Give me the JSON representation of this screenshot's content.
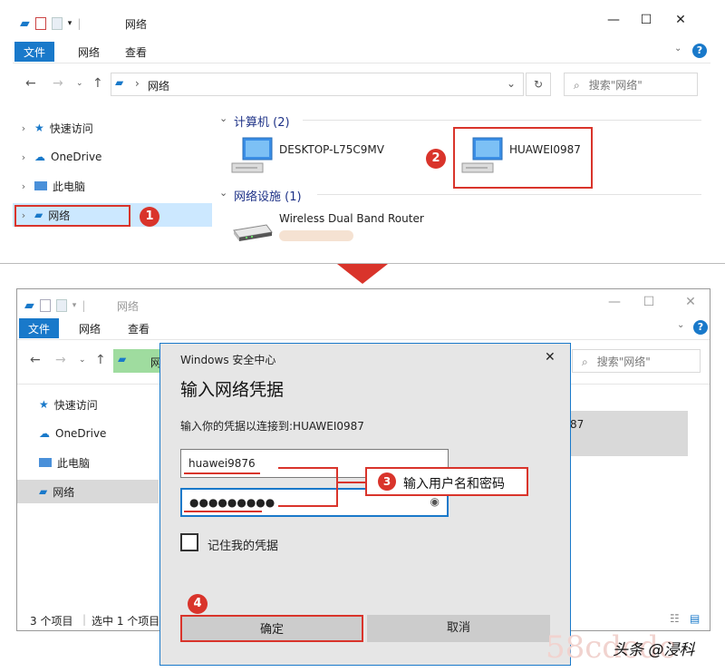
{
  "top": {
    "title": "网络",
    "ribbon_tabs": [
      "文件",
      "网络",
      "查看"
    ],
    "address": "网络",
    "search_placeholder": "搜索\"网络\"",
    "sidebar": [
      "快速访问",
      "OneDrive",
      "此电脑",
      "网络"
    ],
    "group_computers": "计算机 (2)",
    "group_devices": "网络设施 (1)",
    "computers": [
      "DESKTOP-L75C9MV",
      "HUAWEI0987"
    ],
    "device": "Wireless Dual Band Router",
    "badges": [
      "1",
      "2"
    ]
  },
  "bottom": {
    "title": "网络",
    "ribbon_tabs": [
      "文件",
      "网络",
      "查看"
    ],
    "address_partial": "网",
    "search_placeholder": "搜索\"网络\"",
    "sidebar": [
      "快速访问",
      "OneDrive",
      "此电脑",
      "网络"
    ],
    "partial_item": "87",
    "status_count": "3 个项目",
    "status_selected": "选中 1 个项目"
  },
  "dialog": {
    "header": "Windows 安全中心",
    "title": "输入网络凭据",
    "prompt": "输入你的凭据以连接到:HUAWEI0987",
    "username": "huawei9876",
    "password": "●●●●●●●●●",
    "remember_label": "记住我的凭据",
    "ok_label": "确定",
    "cancel_label": "取消",
    "annotation": "输入用户名和密码",
    "badge3": "3",
    "badge4": "4"
  },
  "watermark": {
    "text": "头条 @浸科",
    "faint": "58cdcdc"
  },
  "colors": {
    "accent": "#1979ca",
    "annotation_red": "#d9342b",
    "selection": "#cce8ff"
  }
}
